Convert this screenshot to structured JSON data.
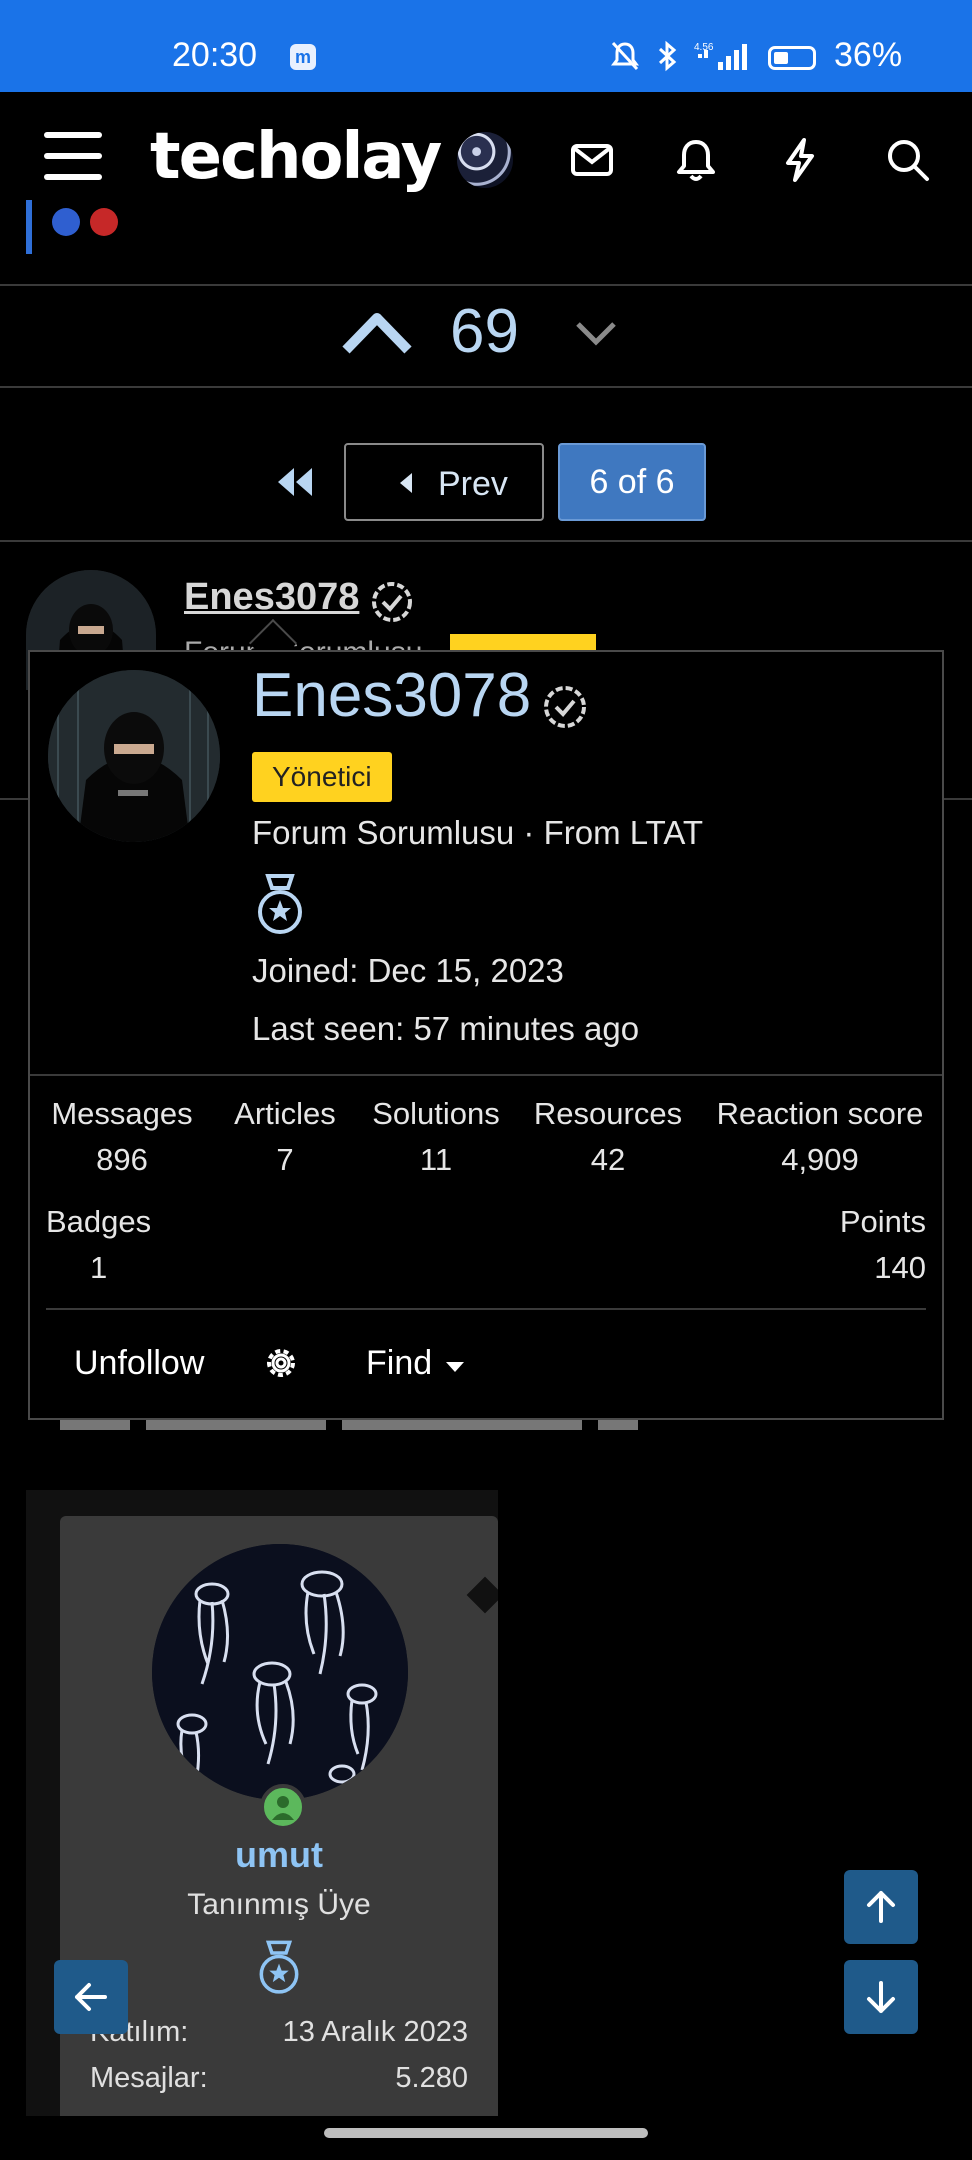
{
  "status_bar": {
    "time": "20:30",
    "app_badge": "m",
    "net_speed": "4.56",
    "battery_pct": "36%",
    "battery_level": 0.36
  },
  "header": {
    "logo": "techolay",
    "icons": [
      "menu-icon",
      "user-avatar",
      "mail-icon",
      "bell-icon",
      "bolt-icon",
      "search-icon"
    ]
  },
  "vote": {
    "count": "69"
  },
  "pagination": {
    "prev_label": "Prev",
    "current_label": "6 of 6"
  },
  "post": {
    "author": "Enes3078",
    "author_sub": "Forum Sorumlusu",
    "badge": "Yönetici"
  },
  "popover": {
    "username": "Enes3078",
    "badge": "Yönetici",
    "title_line": "Forum Sorumlusu · From LTAT",
    "joined": "Joined: Dec 15, 2023",
    "last_seen": "Last seen: 57 minutes ago",
    "stats": [
      {
        "label": "Messages",
        "value": "896"
      },
      {
        "label": "Articles",
        "value": "7"
      },
      {
        "label": "Solutions",
        "value": "11"
      },
      {
        "label": "Resources",
        "value": "42"
      },
      {
        "label": "Reaction score",
        "value": "4,909"
      }
    ],
    "badges": {
      "label": "Badges",
      "value": "1"
    },
    "points": {
      "label": "Points",
      "value": "140"
    },
    "unfollow_label": "Unfollow",
    "find_label": "Find"
  },
  "embedded_card": {
    "name": "umut",
    "rank": "Tanınmış Üye",
    "rows": [
      {
        "label": "Katılım:",
        "value": "13 Aralık 2023"
      },
      {
        "label": "Mesajlar:",
        "value": "5.280"
      }
    ]
  },
  "colors": {
    "accent": "#b9d6f2",
    "status_bar": "#1a73e8",
    "badge": "#ffd21f",
    "page_button": "#3f78c0",
    "fab": "#1f5a8a"
  }
}
